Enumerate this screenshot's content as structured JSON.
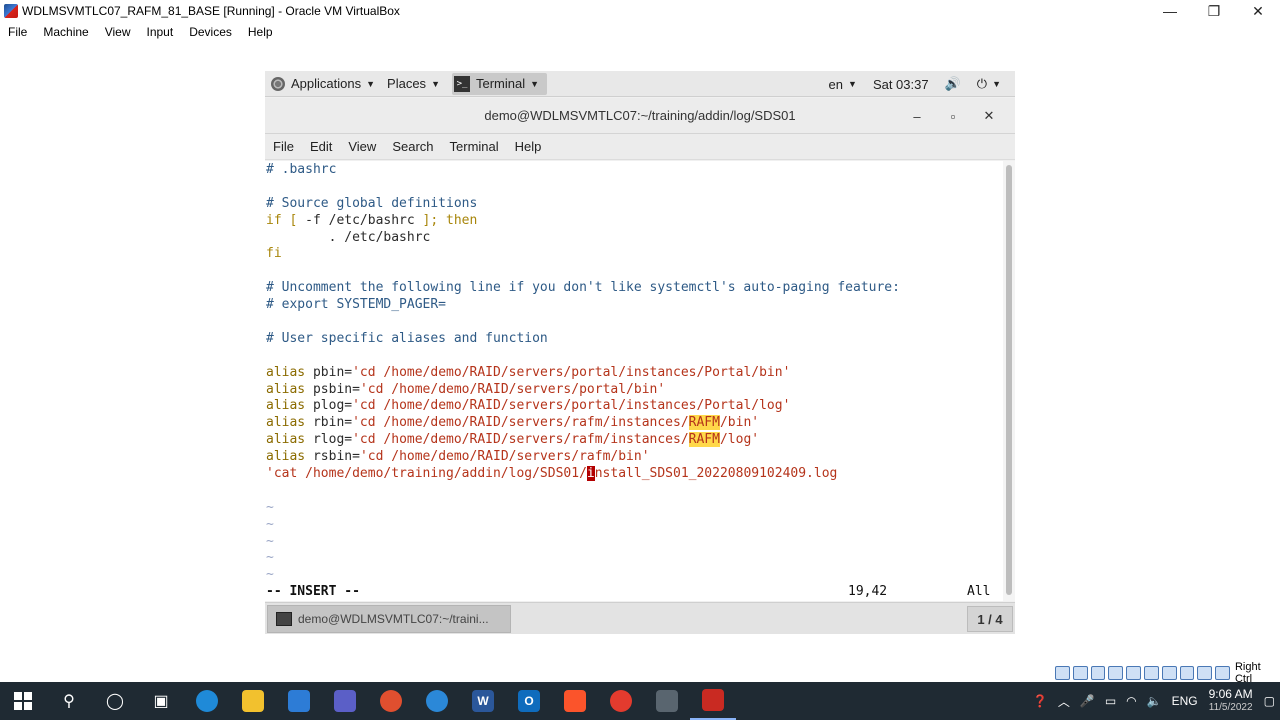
{
  "host": {
    "window_title": "WDLMSVMTLC07_RAFM_81_BASE [Running] - Oracle VM VirtualBox",
    "window_controls": {
      "minimize": "—",
      "restore": "❐",
      "close": "✕"
    },
    "menu": [
      "File",
      "Machine",
      "View",
      "Input",
      "Devices",
      "Help"
    ]
  },
  "gnome_topbar": {
    "applications": "Applications",
    "places": "Places",
    "terminal": "Terminal",
    "language": "en",
    "clock": "Sat 03:37",
    "volume_icon": "🔊",
    "power_icon": "⏻"
  },
  "terminal": {
    "title": "demo@WDLMSVMTLC07:~/training/addin/log/SDS01",
    "controls": {
      "minimize": "–",
      "maximize": "▫",
      "close": "✕"
    },
    "menu": [
      "File",
      "Edit",
      "View",
      "Search",
      "Terminal",
      "Help"
    ],
    "lines": [
      [
        {
          "t": "# .bashrc",
          "c": "c-comment"
        }
      ],
      [],
      [
        {
          "t": "# Source global definitions",
          "c": "c-comment"
        }
      ],
      [
        {
          "t": "if [ ",
          "c": "c-kw"
        },
        {
          "t": "-f /etc/bashrc ",
          "c": "c-text"
        },
        {
          "t": "]; then",
          "c": "c-kw"
        }
      ],
      [
        {
          "t": "        . /etc/bashrc",
          "c": "c-text"
        }
      ],
      [
        {
          "t": "fi",
          "c": "c-kw"
        }
      ],
      [],
      [
        {
          "t": "# Uncomment the following line if you don't like systemctl's auto-paging feature:",
          "c": "c-comment"
        }
      ],
      [
        {
          "t": "# export SYSTEMD_PAGER=",
          "c": "c-comment"
        }
      ],
      [],
      [
        {
          "t": "# User specific aliases and function",
          "c": "c-comment"
        }
      ],
      [],
      [
        {
          "t": "alias ",
          "c": "c-alias"
        },
        {
          "t": "pbin=",
          "c": "c-text"
        },
        {
          "t": "'cd /home/demo/RAID/servers/portal/instances/Portal/bin'",
          "c": "c-str"
        }
      ],
      [
        {
          "t": "alias ",
          "c": "c-alias"
        },
        {
          "t": "psbin=",
          "c": "c-text"
        },
        {
          "t": "'cd /home/demo/RAID/servers/portal/bin'",
          "c": "c-str"
        }
      ],
      [
        {
          "t": "alias ",
          "c": "c-alias"
        },
        {
          "t": "plog=",
          "c": "c-text"
        },
        {
          "t": "'cd /home/demo/RAID/servers/portal/instances/Portal/log'",
          "c": "c-str"
        }
      ],
      [
        {
          "t": "alias ",
          "c": "c-alias"
        },
        {
          "t": "rbin=",
          "c": "c-text"
        },
        {
          "t": "'cd /home/demo/RAID/servers/rafm/instances/",
          "c": "c-str"
        },
        {
          "t": "RAFM",
          "c": "hl"
        },
        {
          "t": "/bin'",
          "c": "c-str"
        }
      ],
      [
        {
          "t": "alias ",
          "c": "c-alias"
        },
        {
          "t": "rlog=",
          "c": "c-text"
        },
        {
          "t": "'cd /home/demo/RAID/servers/rafm/instances/",
          "c": "c-str"
        },
        {
          "t": "RAFM",
          "c": "hl"
        },
        {
          "t": "/log'",
          "c": "c-str"
        }
      ],
      [
        {
          "t": "alias ",
          "c": "c-alias"
        },
        {
          "t": "rsbin=",
          "c": "c-text"
        },
        {
          "t": "'cd /home/demo/RAID/servers/rafm/bin'",
          "c": "c-str"
        }
      ],
      [
        {
          "t": "'cat /home/demo/training/addin/log/SDS01/",
          "c": "c-str"
        },
        {
          "t": "i",
          "c": "cursor"
        },
        {
          "t": "nstall_SDS01_20220809102409.log",
          "c": "c-str"
        }
      ],
      [],
      [
        {
          "t": "~",
          "c": "c-tilde"
        }
      ],
      [
        {
          "t": "~",
          "c": "c-tilde"
        }
      ],
      [
        {
          "t": "~",
          "c": "c-tilde"
        }
      ],
      [
        {
          "t": "~",
          "c": "c-tilde"
        }
      ],
      [
        {
          "t": "~",
          "c": "c-tilde"
        }
      ]
    ],
    "status_mode": "-- INSERT --",
    "status_position": "19,42",
    "status_scroll": "All"
  },
  "gnome_bottombar": {
    "task_label": "demo@WDLMSVMTLC07:~/traini...",
    "workspace": "1 / 4"
  },
  "vbox_status": {
    "host_key": "Right Ctrl"
  },
  "win_taskbar": {
    "language": "ENG",
    "time": "9:06 AM",
    "date": "11/5/2022"
  }
}
